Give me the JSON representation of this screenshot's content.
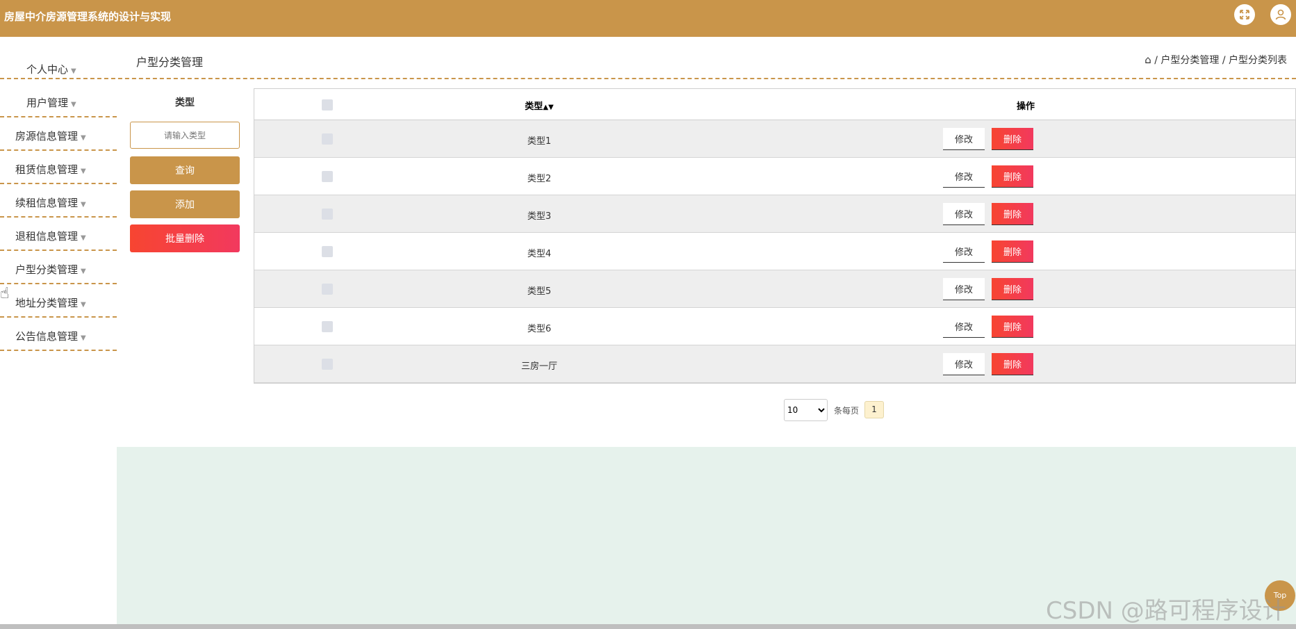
{
  "app": {
    "title": "房屋中介房源管理系统的设计与实现",
    "fullscreen_icon": "expand-icon",
    "user_icon": "user-icon"
  },
  "sidebar": {
    "items": [
      {
        "label": "个人中心"
      },
      {
        "label": "用户管理"
      },
      {
        "label": "房源信息管理"
      },
      {
        "label": "租赁信息管理"
      },
      {
        "label": "续租信息管理"
      },
      {
        "label": "退租信息管理"
      },
      {
        "label": "户型分类管理"
      },
      {
        "label": "地址分类管理"
      },
      {
        "label": "公告信息管理"
      }
    ]
  },
  "page": {
    "title": "户型分类管理",
    "breadcrumb": {
      "home_icon": "home-icon",
      "level1": "户型分类管理",
      "level2": "户型分类列表",
      "sep": "/"
    }
  },
  "search": {
    "label": "类型",
    "placeholder": "请输入类型",
    "query_label": "查询",
    "add_label": "添加",
    "batch_delete_label": "批量删除"
  },
  "table": {
    "headers": {
      "type": "类型",
      "sort_icon": "sort-icon",
      "actions": "操作"
    },
    "edit_label": "修改",
    "delete_label": "删除",
    "rows": [
      {
        "type": "类型1"
      },
      {
        "type": "类型2"
      },
      {
        "type": "类型3"
      },
      {
        "type": "类型4"
      },
      {
        "type": "类型5"
      },
      {
        "type": "类型6"
      },
      {
        "type": "三房一厅"
      }
    ]
  },
  "pagination": {
    "page_size": "10",
    "per_page_label": "条每页",
    "current_page": "1"
  },
  "misc": {
    "top_button": "Top",
    "watermark": "CSDN @路可程序设计"
  },
  "colors": {
    "brand": "#c9954a",
    "danger": "#f2395e",
    "footer_bg": "#e6f2ec"
  }
}
